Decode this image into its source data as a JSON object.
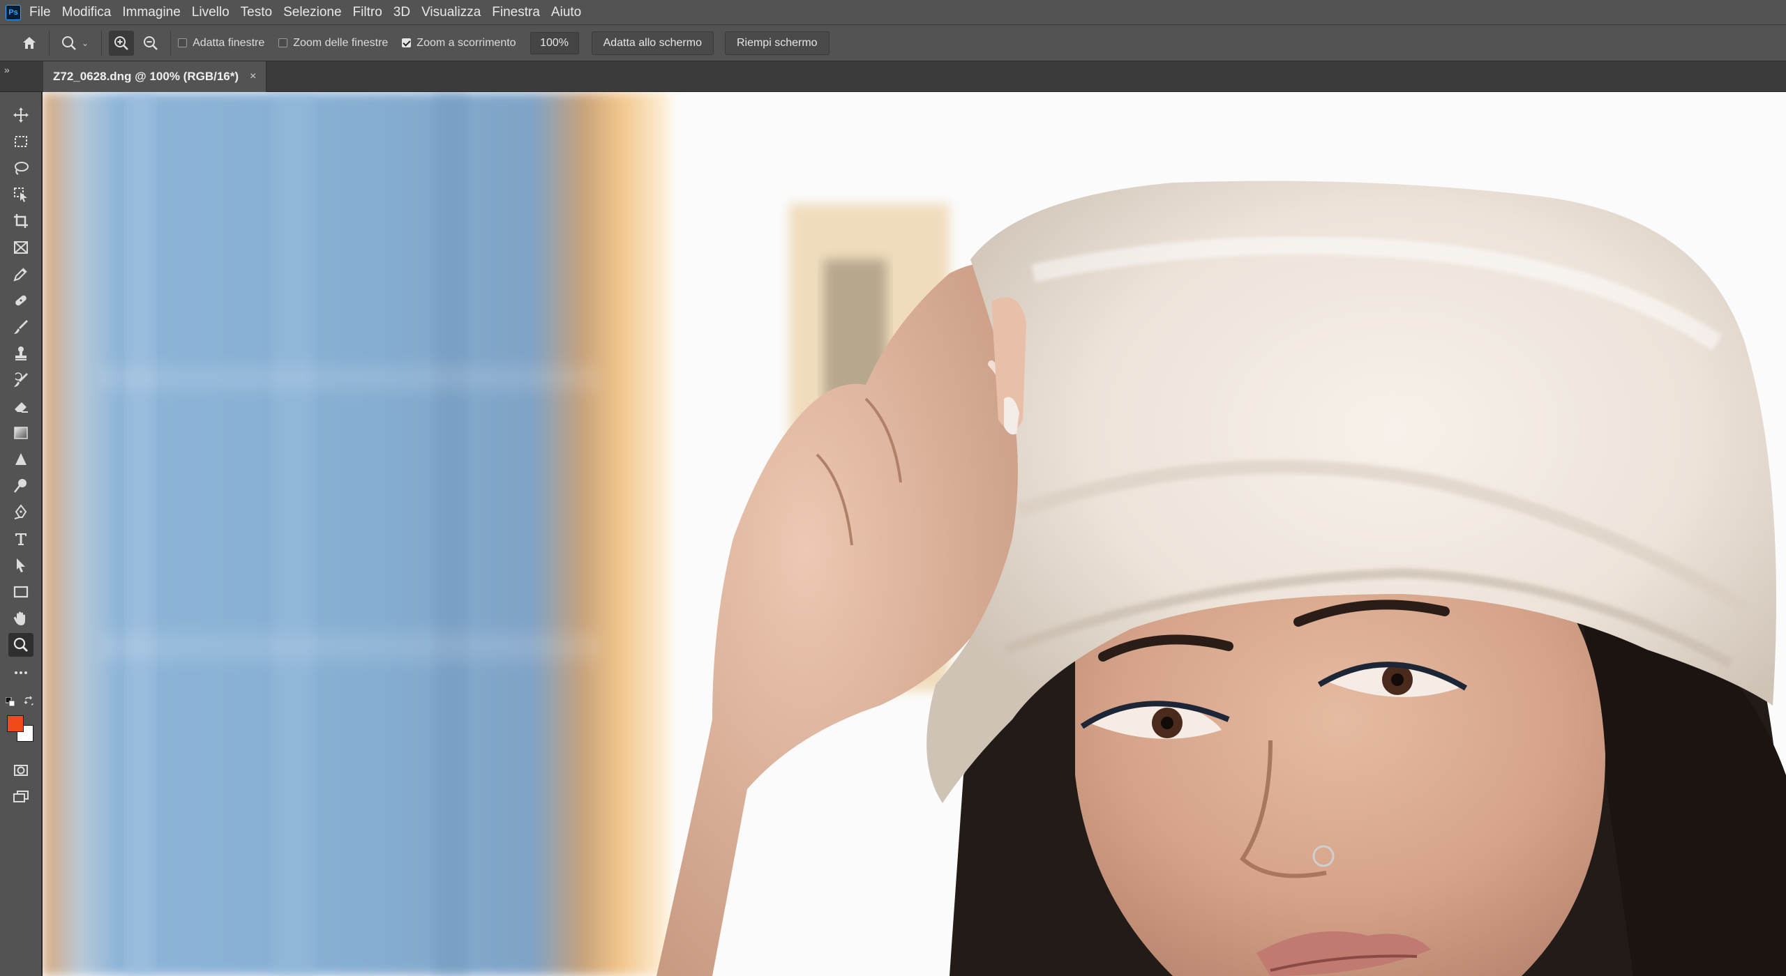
{
  "app": {
    "logo_text": "Ps",
    "menu": [
      "File",
      "Modifica",
      "Immagine",
      "Livello",
      "Testo",
      "Selezione",
      "Filtro",
      "3D",
      "Visualizza",
      "Finestra",
      "Aiuto"
    ]
  },
  "options": {
    "adatta_finestre": {
      "label": "Adatta finestre",
      "checked": false
    },
    "zoom_finestre": {
      "label": "Zoom delle finestre",
      "checked": false
    },
    "zoom_scorrimento": {
      "label": "Zoom a scorrimento",
      "checked": true
    },
    "zoom_percent": "100%",
    "fit_screen_label": "Adatta allo schermo",
    "fill_screen_label": "Riempi schermo"
  },
  "document": {
    "tab_title": "Z72_0628.dng @ 100% (RGB/16*)",
    "close_glyph": "×"
  },
  "tools": [
    "move-icon",
    "rect-marquee-icon",
    "lasso-icon",
    "object-select-icon",
    "crop-icon",
    "frame-icon",
    "eyedropper-icon",
    "healing-brush-icon",
    "brush-icon",
    "clone-stamp-icon",
    "history-brush-icon",
    "eraser-icon",
    "gradient-icon",
    "sharpen-icon",
    "dodge-icon",
    "pen-icon",
    "type-icon",
    "path-select-icon",
    "rectangle-icon",
    "hand-icon",
    "zoom-icon",
    "more-tools-icon"
  ],
  "colors": {
    "foreground": "#f04a18",
    "background": "#ffffff",
    "ui_panel": "#535353"
  }
}
